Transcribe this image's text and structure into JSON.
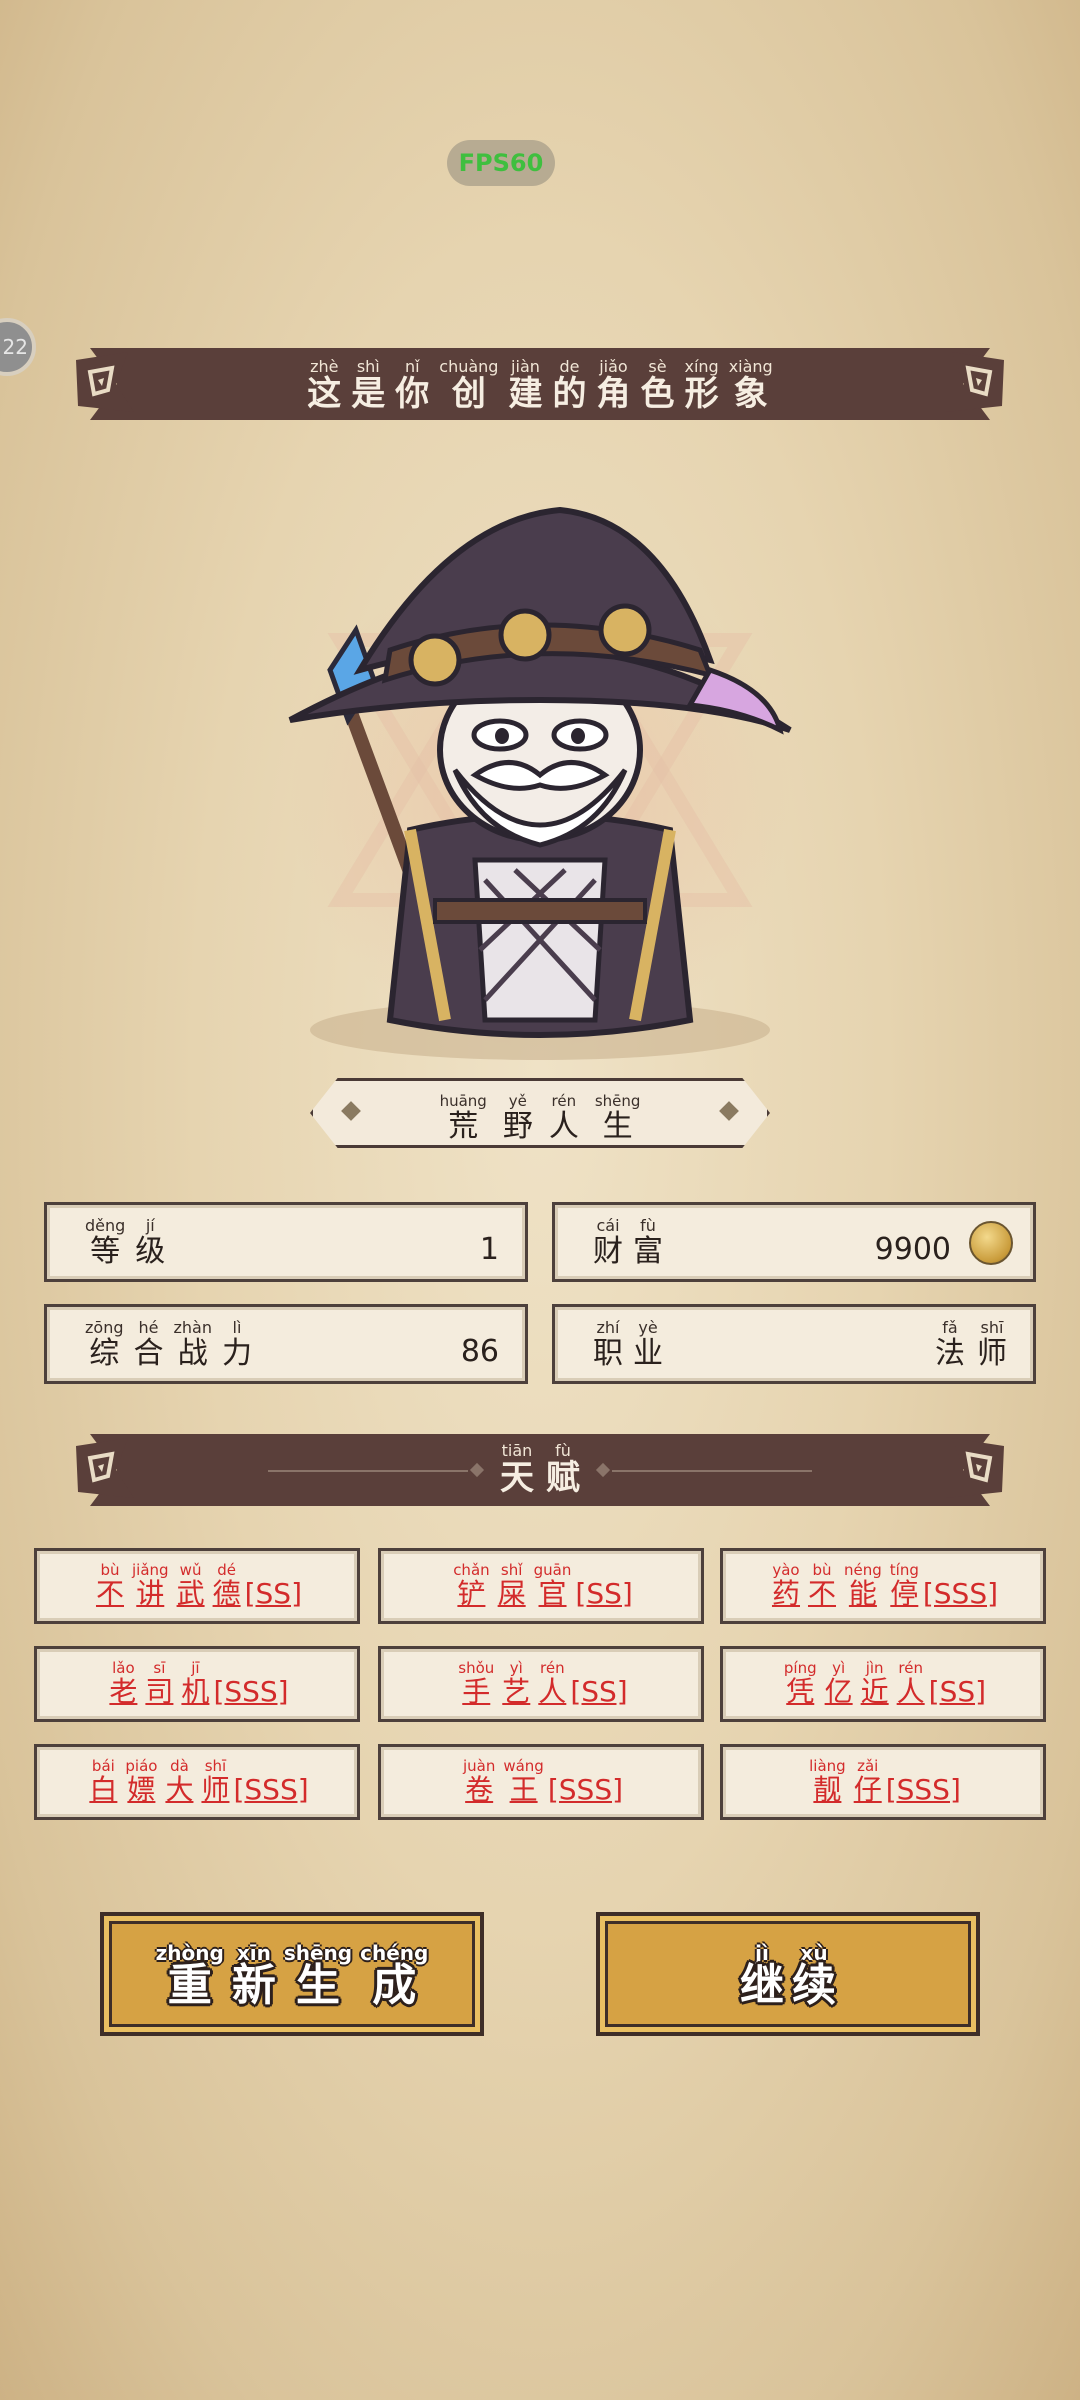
{
  "fps": "FPS60",
  "side_badge": "22",
  "header": {
    "chars": [
      {
        "py": "zhè",
        "hz": "这"
      },
      {
        "py": "shì",
        "hz": "是"
      },
      {
        "py": "nǐ",
        "hz": "你"
      },
      {
        "py": "chuàng",
        "hz": "创"
      },
      {
        "py": "jiàn",
        "hz": "建"
      },
      {
        "py": "de",
        "hz": "的"
      },
      {
        "py": "jiǎo",
        "hz": "角"
      },
      {
        "py": "sè",
        "hz": "色"
      },
      {
        "py": "xíng",
        "hz": "形"
      },
      {
        "py": "xiàng",
        "hz": "象"
      }
    ]
  },
  "character_name": [
    {
      "py": "huāng",
      "hz": "荒"
    },
    {
      "py": "yě",
      "hz": "野"
    },
    {
      "py": "rén",
      "hz": "人"
    },
    {
      "py": "shēng",
      "hz": "生"
    }
  ],
  "stats": {
    "level": {
      "label": [
        {
          "py": "děng",
          "hz": "等"
        },
        {
          "py": "jí",
          "hz": "级"
        }
      ],
      "value": "1"
    },
    "wealth": {
      "label": [
        {
          "py": "cái",
          "hz": "财"
        },
        {
          "py": "fù",
          "hz": "富"
        }
      ],
      "value": "9900"
    },
    "power": {
      "label": [
        {
          "py": "zōng",
          "hz": "综"
        },
        {
          "py": "hé",
          "hz": "合"
        },
        {
          "py": "zhàn",
          "hz": "战"
        },
        {
          "py": "lì",
          "hz": "力"
        }
      ],
      "value": "86"
    },
    "job": {
      "label": [
        {
          "py": "zhí",
          "hz": "职"
        },
        {
          "py": "yè",
          "hz": "业"
        }
      ],
      "value": [
        {
          "py": "fǎ",
          "hz": "法"
        },
        {
          "py": "shī",
          "hz": "师"
        }
      ]
    }
  },
  "talent_header": [
    {
      "py": "tiān",
      "hz": "天"
    },
    {
      "py": "fù",
      "hz": "赋"
    }
  ],
  "talents": [
    {
      "chars": [
        {
          "py": "bù",
          "hz": "不"
        },
        {
          "py": "jiǎng",
          "hz": "讲"
        },
        {
          "py": "wǔ",
          "hz": "武"
        },
        {
          "py": "dé",
          "hz": "德"
        }
      ],
      "grade": "[SS]"
    },
    {
      "chars": [
        {
          "py": "chǎn",
          "hz": "铲"
        },
        {
          "py": "shǐ",
          "hz": "屎"
        },
        {
          "py": "guān",
          "hz": "官"
        }
      ],
      "grade": "[SS]"
    },
    {
      "chars": [
        {
          "py": "yào",
          "hz": "药"
        },
        {
          "py": "bù",
          "hz": "不"
        },
        {
          "py": "néng",
          "hz": "能"
        },
        {
          "py": "tíng",
          "hz": "停"
        }
      ],
      "grade": "[SSS]"
    },
    {
      "chars": [
        {
          "py": "lǎo",
          "hz": "老"
        },
        {
          "py": "sī",
          "hz": "司"
        },
        {
          "py": "jī",
          "hz": "机"
        }
      ],
      "grade": "[SSS]"
    },
    {
      "chars": [
        {
          "py": "shǒu",
          "hz": "手"
        },
        {
          "py": "yì",
          "hz": "艺"
        },
        {
          "py": "rén",
          "hz": "人"
        }
      ],
      "grade": "[SS]"
    },
    {
      "chars": [
        {
          "py": "píng",
          "hz": "凭"
        },
        {
          "py": "yì",
          "hz": "亿"
        },
        {
          "py": "jìn",
          "hz": "近"
        },
        {
          "py": "rén",
          "hz": "人"
        }
      ],
      "grade": "[SS]"
    },
    {
      "chars": [
        {
          "py": "bái",
          "hz": "白"
        },
        {
          "py": "piáo",
          "hz": "嫖"
        },
        {
          "py": "dà",
          "hz": "大"
        },
        {
          "py": "shī",
          "hz": "师"
        }
      ],
      "grade": "[SSS]"
    },
    {
      "chars": [
        {
          "py": "juàn",
          "hz": "卷"
        },
        {
          "py": "wáng",
          "hz": "王"
        }
      ],
      "grade": "[SSS]"
    },
    {
      "chars": [
        {
          "py": "liàng",
          "hz": "靓"
        },
        {
          "py": "zǎi",
          "hz": "仔"
        }
      ],
      "grade": "[SSS]"
    }
  ],
  "buttons": {
    "regenerate": [
      {
        "py": "zhòng",
        "hz": "重"
      },
      {
        "py": "xīn",
        "hz": "新"
      },
      {
        "py": "shēng",
        "hz": "生"
      },
      {
        "py": "chéng",
        "hz": "成"
      }
    ],
    "continue": [
      {
        "py": "jì",
        "hz": "继"
      },
      {
        "py": "xù",
        "hz": "续"
      }
    ]
  },
  "colors": {
    "banner": "#5a3f3a",
    "talent_text": "#d32b2b",
    "button": "#d6a244",
    "fps_text": "#3fbf3f"
  }
}
